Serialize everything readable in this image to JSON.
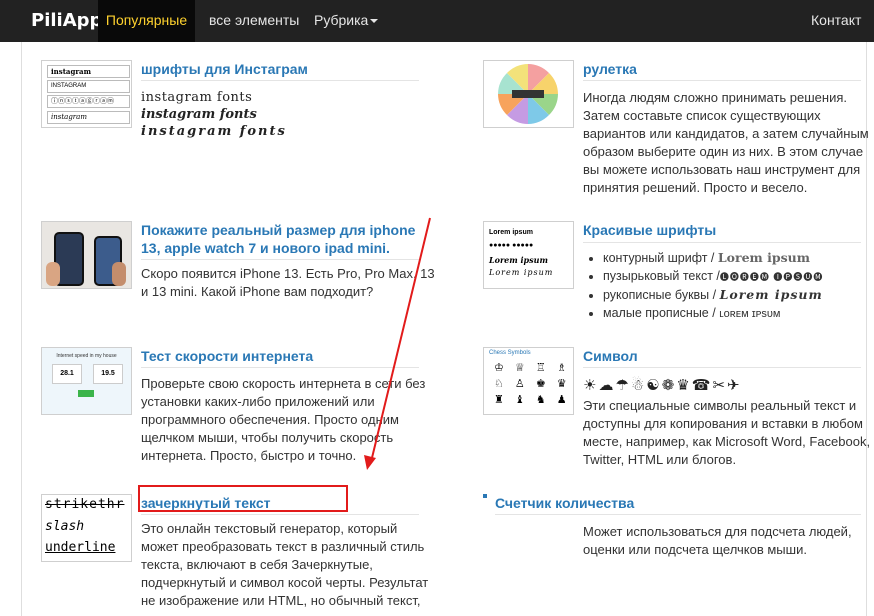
{
  "navbar": {
    "brand": "PiliApp",
    "items": [
      "Популярные",
      "все элементы",
      "Рубрика",
      "Контакт"
    ]
  },
  "cards": {
    "insta": {
      "title": "шрифты для Инстаграм",
      "thumb_lines": [
        "instagram",
        "INSTAGRAM",
        "ⓘⓝⓢⓣⓐⓖⓡⓐⓜ",
        "instagram"
      ],
      "samples": [
        "instagram fonts",
        "instagram fonts",
        "instagram fonts"
      ]
    },
    "roulette": {
      "title": "рулетка",
      "desc_lines": [
        "Иногда людям сложно принимать решения.",
        "Затем составьте список существующих",
        "вариантов или кандидатов, а затем случайным",
        "образом выберите один из них. В этом случае",
        "вы можете использовать наш инструмент для",
        "принятия решений. Просто и весело."
      ]
    },
    "iphone": {
      "title_lines": [
        "Покажите реальный размер для iphone",
        "13, apple watch 7 и нового ipad mini."
      ],
      "desc_lines": [
        "Скоро появится iPhone 13. Есть Pro, Pro Max, 13",
        "и 13 mini. Какой iPhone вам подходит?"
      ]
    },
    "beautiful": {
      "title": "Красивые шрифты",
      "thumb_lines": [
        "Lorem ipsum",
        "●●●●● ●●●●●",
        "Lorem ipsum",
        "Lorem ipsum"
      ],
      "bullets": [
        {
          "label": "контурный шрифт / ",
          "sample": "Lorem ipsum"
        },
        {
          "label": "пузырьковый текст /",
          "sample": "🅛🅞🅡🅔🅜 🅘🅟🅢🅤🅜"
        },
        {
          "label": "рукописные буквы / ",
          "sample": "Lorem ipsum"
        },
        {
          "label": "малые прописные / ",
          "sample": "ʟᴏʀᴇᴍ ɪᴘsᴜᴍ"
        }
      ]
    },
    "speed": {
      "title": "Тест скорости интернета",
      "thumb_header": "Internet speed in my house",
      "thumb_values": [
        "28.1",
        "19.5"
      ],
      "desc_lines": [
        "Проверьте свою скорость интернета в сети без",
        "установки каких-либо приложений или",
        "программного обеспечения. Просто одним",
        "щелчком мыши, чтобы получить скорость",
        "интернета. Просто, быстро и точно."
      ]
    },
    "symbol": {
      "title": "Символ",
      "thumb_header": "Chess Symbols",
      "chess_rows": [
        "♔ ♕ ♖ ♗",
        "♘ ♙ ♚ ♛",
        "♜ ♝ ♞ ♟"
      ],
      "symbols": "☀☁☂☃☯❁♛☎✂✈",
      "desc_lines": [
        "Эти специальные символы реальный текст и",
        "доступны для копирования и вставки в любом",
        "месте, например, как Microsoft Word, Facebook,",
        "Twitter, HTML или блогов."
      ]
    },
    "strike": {
      "title": "зачеркнутый текст",
      "thumb_lines": [
        "strikethr",
        "slash",
        "underline"
      ],
      "desc_lines": [
        "Это онлайн текстовый генератор, который",
        "может преобразовать текст в различный стиль",
        "текста, включают в себя Зачеркнутые,",
        "подчеркнутый и символ косой черты. Результат",
        "не изображение или HTML, но обычный текст,"
      ]
    },
    "counter": {
      "title": "Счетчик количества",
      "desc_lines": [
        "Может использоваться для подсчета людей,",
        "оценки или подсчета щелчков мыши."
      ]
    }
  },
  "colors": {
    "accent": "#2a78b5",
    "nav_bg": "#222222",
    "nav_active": "#ffd22e",
    "highlight": "#e21b1b"
  }
}
